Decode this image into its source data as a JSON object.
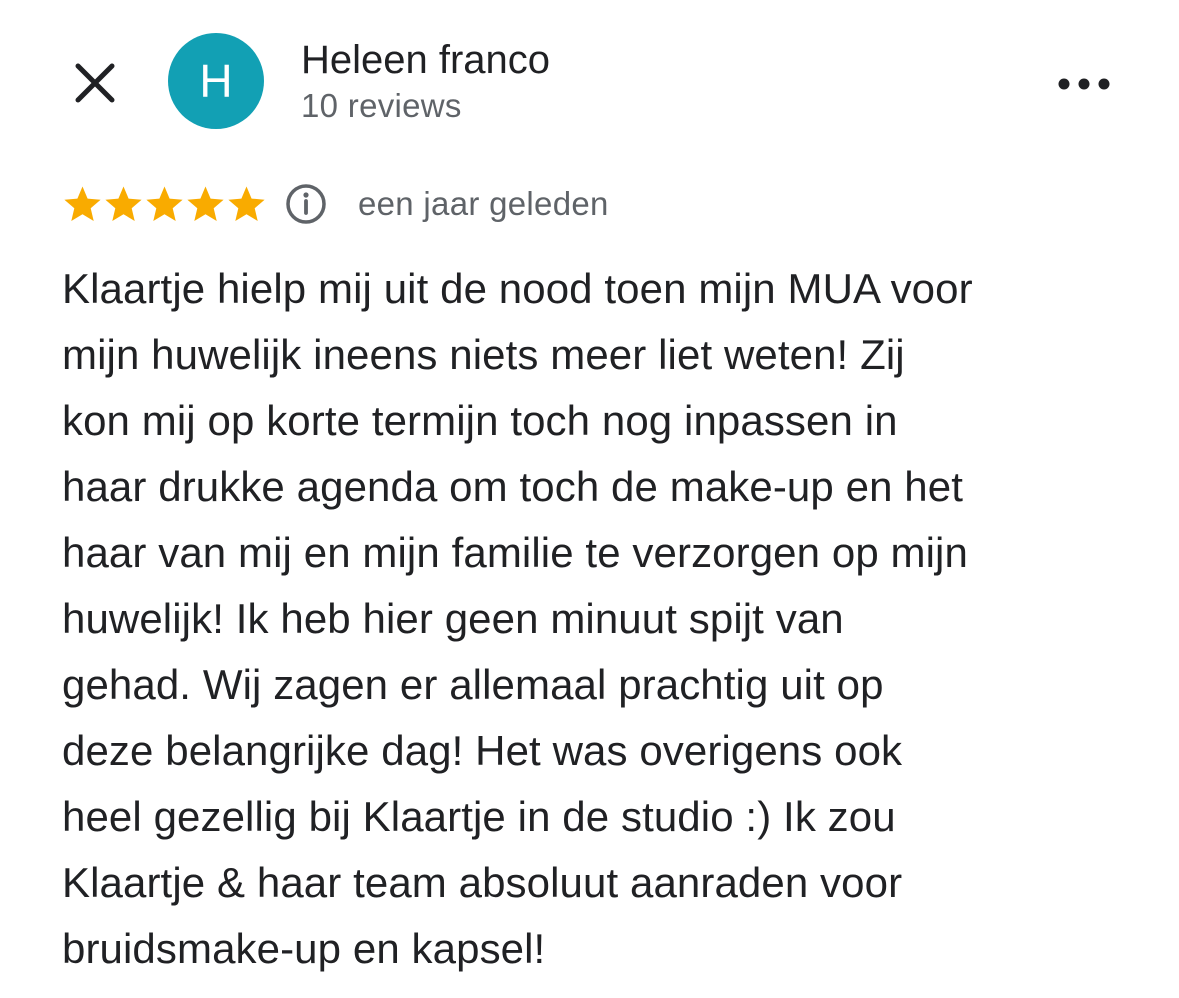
{
  "header": {
    "close_icon": "close-icon",
    "avatar_initial": "H",
    "author_name": "Heleen franco",
    "review_count": "10 reviews",
    "more_icon": "more-horizontal-icon"
  },
  "colors": {
    "avatar_bg": "#12a0b4",
    "star": "#f9ab00",
    "secondary_text": "#5f6368",
    "primary_text": "#202124"
  },
  "review": {
    "rating": 5,
    "rating_max": 5,
    "info_icon": "info-icon",
    "date": "een jaar geleden",
    "lines": [
      "Klaartje hielp mij uit de nood toen mijn MUA voor",
      "mijn huwelijk ineens niets meer liet weten! Zij",
      "kon mij op korte termijn toch nog inpassen in",
      "haar drukke agenda om toch de make-up en het",
      "haar van mij en mijn familie te verzorgen op mijn",
      "huwelijk! Ik heb hier geen minuut spijt van",
      "gehad. Wij zagen er allemaal prachtig uit op",
      "deze belangrijke dag! Het was overigens ook",
      "heel gezellig bij Klaartje in de studio :) Ik zou",
      "Klaartje & haar team absoluut aanraden voor",
      "bruidsmake-up en kapsel!"
    ]
  }
}
